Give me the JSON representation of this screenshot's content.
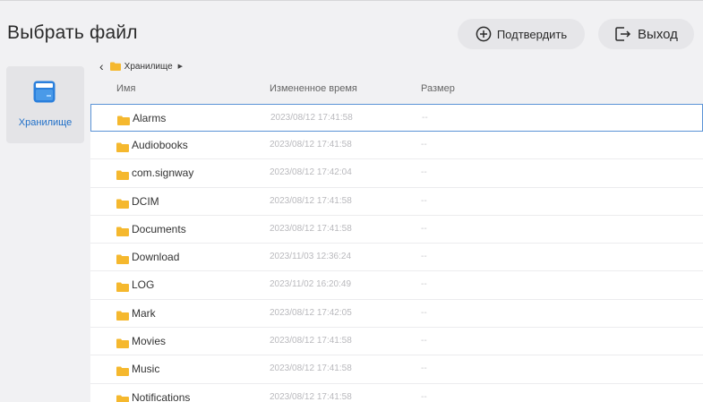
{
  "header": {
    "title": "Выбрать файл",
    "confirm_label": "Подтвердить",
    "exit_label": "Выход"
  },
  "sidebar": {
    "items": [
      {
        "label": "Хранилище",
        "icon": "storage-icon",
        "active": true
      }
    ]
  },
  "breadcrumb": {
    "back_icon": "chevron-left-icon",
    "path": "Хранилище",
    "separator_icon": "caret-right-icon"
  },
  "table": {
    "columns": [
      "Имя",
      "Измененное время",
      "Размер"
    ],
    "rows": [
      {
        "name": "Alarms",
        "modified": "2023/08/12 17:41:58",
        "size": "--",
        "selected": true
      },
      {
        "name": "Audiobooks",
        "modified": "2023/08/12 17:41:58",
        "size": "--"
      },
      {
        "name": "com.signway",
        "modified": "2023/08/12 17:42:04",
        "size": "--"
      },
      {
        "name": "DCIM",
        "modified": "2023/08/12 17:41:58",
        "size": "--"
      },
      {
        "name": "Documents",
        "modified": "2023/08/12 17:41:58",
        "size": "--"
      },
      {
        "name": "Download",
        "modified": "2023/11/03 12:36:24",
        "size": "--"
      },
      {
        "name": "LOG",
        "modified": "2023/11/02 16:20:49",
        "size": "--"
      },
      {
        "name": "Mark",
        "modified": "2023/08/12 17:42:05",
        "size": "--"
      },
      {
        "name": "Movies",
        "modified": "2023/08/12 17:41:58",
        "size": "--"
      },
      {
        "name": "Music",
        "modified": "2023/08/12 17:41:58",
        "size": "--"
      },
      {
        "name": "Notifications",
        "modified": "2023/08/12 17:41:58",
        "size": "--"
      }
    ]
  },
  "colors": {
    "accent": "#1f6fc8",
    "selection_border": "#5a93d6",
    "folder": "#f5b82e",
    "background": "#f1f1f3"
  }
}
